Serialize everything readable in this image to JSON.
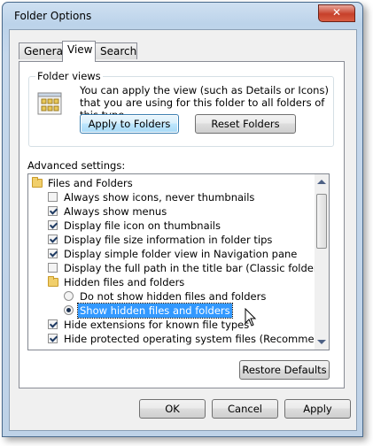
{
  "window": {
    "title": "Folder Options",
    "close_symbol": "✕"
  },
  "tabs": [
    {
      "label": "General",
      "active": false
    },
    {
      "label": "View",
      "active": true
    },
    {
      "label": "Search",
      "active": false
    }
  ],
  "folder_views": {
    "group_label": "Folder views",
    "description": "You can apply the view (such as Details or Icons) that you are using for this folder to all folders of this type.",
    "apply_button": "Apply to Folders",
    "reset_button": "Reset Folders",
    "icon": "folder-views-icon"
  },
  "advanced": {
    "label": "Advanced settings:",
    "items": [
      {
        "type": "folder",
        "label": "Files and Folders",
        "indent": 0
      },
      {
        "type": "checkbox",
        "label": "Always show icons, never thumbnails",
        "checked": false,
        "indent": 1
      },
      {
        "type": "checkbox",
        "label": "Always show menus",
        "checked": true,
        "indent": 1
      },
      {
        "type": "checkbox",
        "label": "Display file icon on thumbnails",
        "checked": true,
        "indent": 1
      },
      {
        "type": "checkbox",
        "label": "Display file size information in folder tips",
        "checked": true,
        "indent": 1
      },
      {
        "type": "checkbox",
        "label": "Display simple folder view in Navigation pane",
        "checked": true,
        "indent": 1
      },
      {
        "type": "checkbox",
        "label": "Display the full path in the title bar (Classic folders only)",
        "checked": false,
        "indent": 1
      },
      {
        "type": "folder",
        "label": "Hidden files and folders",
        "indent": 1
      },
      {
        "type": "radio",
        "label": "Do not show hidden files and folders",
        "checked": false,
        "indent": 2
      },
      {
        "type": "radio",
        "label": "Show hidden files and folders",
        "checked": true,
        "selected": true,
        "indent": 2
      },
      {
        "type": "checkbox",
        "label": "Hide extensions for known file types",
        "checked": true,
        "indent": 1
      },
      {
        "type": "checkbox",
        "label": "Hide protected operating system files (Recommended)",
        "checked": true,
        "indent": 1
      }
    ]
  },
  "restore_defaults": "Restore Defaults",
  "dialog_buttons": {
    "ok": "OK",
    "cancel": "Cancel",
    "apply": "Apply"
  },
  "colors": {
    "selection": "#3399ff",
    "title_gradient_top": "#cfe0f1",
    "close_button": "#c7402a"
  }
}
